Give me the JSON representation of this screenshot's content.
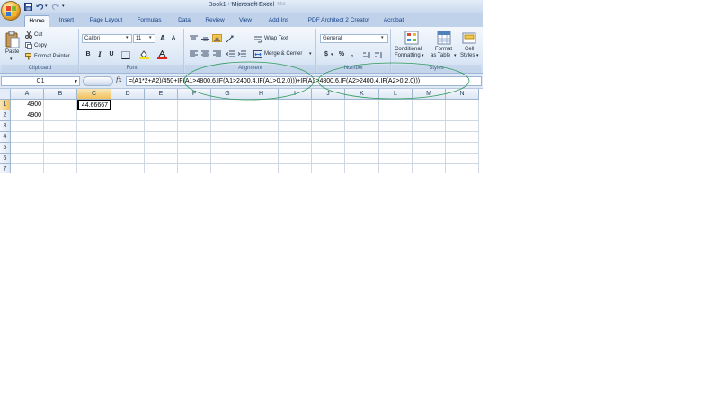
{
  "window": {
    "title": "Book1 - Microsoft Excel",
    "faded_tab_text": "Programm Ansicht - Mic"
  },
  "tabs": [
    "Home",
    "Insert",
    "Page Layout",
    "Formulas",
    "Data",
    "Review",
    "View",
    "Add-Ins",
    "PDF Architect 2 Creator",
    "Acrobat"
  ],
  "active_tab": "Home",
  "ribbon": {
    "clipboard": {
      "label": "Clipboard",
      "paste": "Paste",
      "cut": "Cut",
      "copy": "Copy",
      "format_painter": "Format Painter"
    },
    "font": {
      "label": "Font",
      "name": "Calibri",
      "size": "11",
      "bold": "B",
      "italic": "I",
      "underline": "U",
      "grow": "A",
      "shrink": "A"
    },
    "alignment": {
      "label": "Alignment",
      "wrap_text": "Wrap Text",
      "merge_center": "Merge & Center"
    },
    "number": {
      "label": "Number",
      "format": "General",
      "currency": "$",
      "percent": "%",
      "comma": ","
    },
    "styles": {
      "label": "Styles",
      "conditional_formatting": [
        "Conditional",
        "Formatting"
      ],
      "format_as_table": [
        "Format",
        "as Table"
      ],
      "cell_styles": [
        "Cell",
        "Styles"
      ]
    }
  },
  "formula_bar": {
    "name_box": "C1",
    "fx": "fx",
    "formula": "=(A1*2+A2)/450+IF(A1>4800,6,IF(A1>2400,4,IF(A1>0,2,0)))+IF(A2>4800,6,IF(A2>2400,4,IF(A2>0,2,0)))"
  },
  "grid": {
    "columns": [
      "A",
      "B",
      "C",
      "D",
      "E",
      "F",
      "G",
      "H",
      "I",
      "J",
      "K",
      "L",
      "M",
      "N"
    ],
    "rows": [
      "1",
      "2",
      "3",
      "4",
      "5",
      "6",
      "7"
    ],
    "selected_col": "C",
    "selected_row": "1",
    "cells": {
      "A1": "4900",
      "A2": "4900",
      "C1": "44.66667"
    }
  },
  "colors": {
    "ribbon_bg": "#dbe7f5",
    "header_selected": "#f1c15f",
    "annotation_ellipse": "#2e9a5a"
  }
}
